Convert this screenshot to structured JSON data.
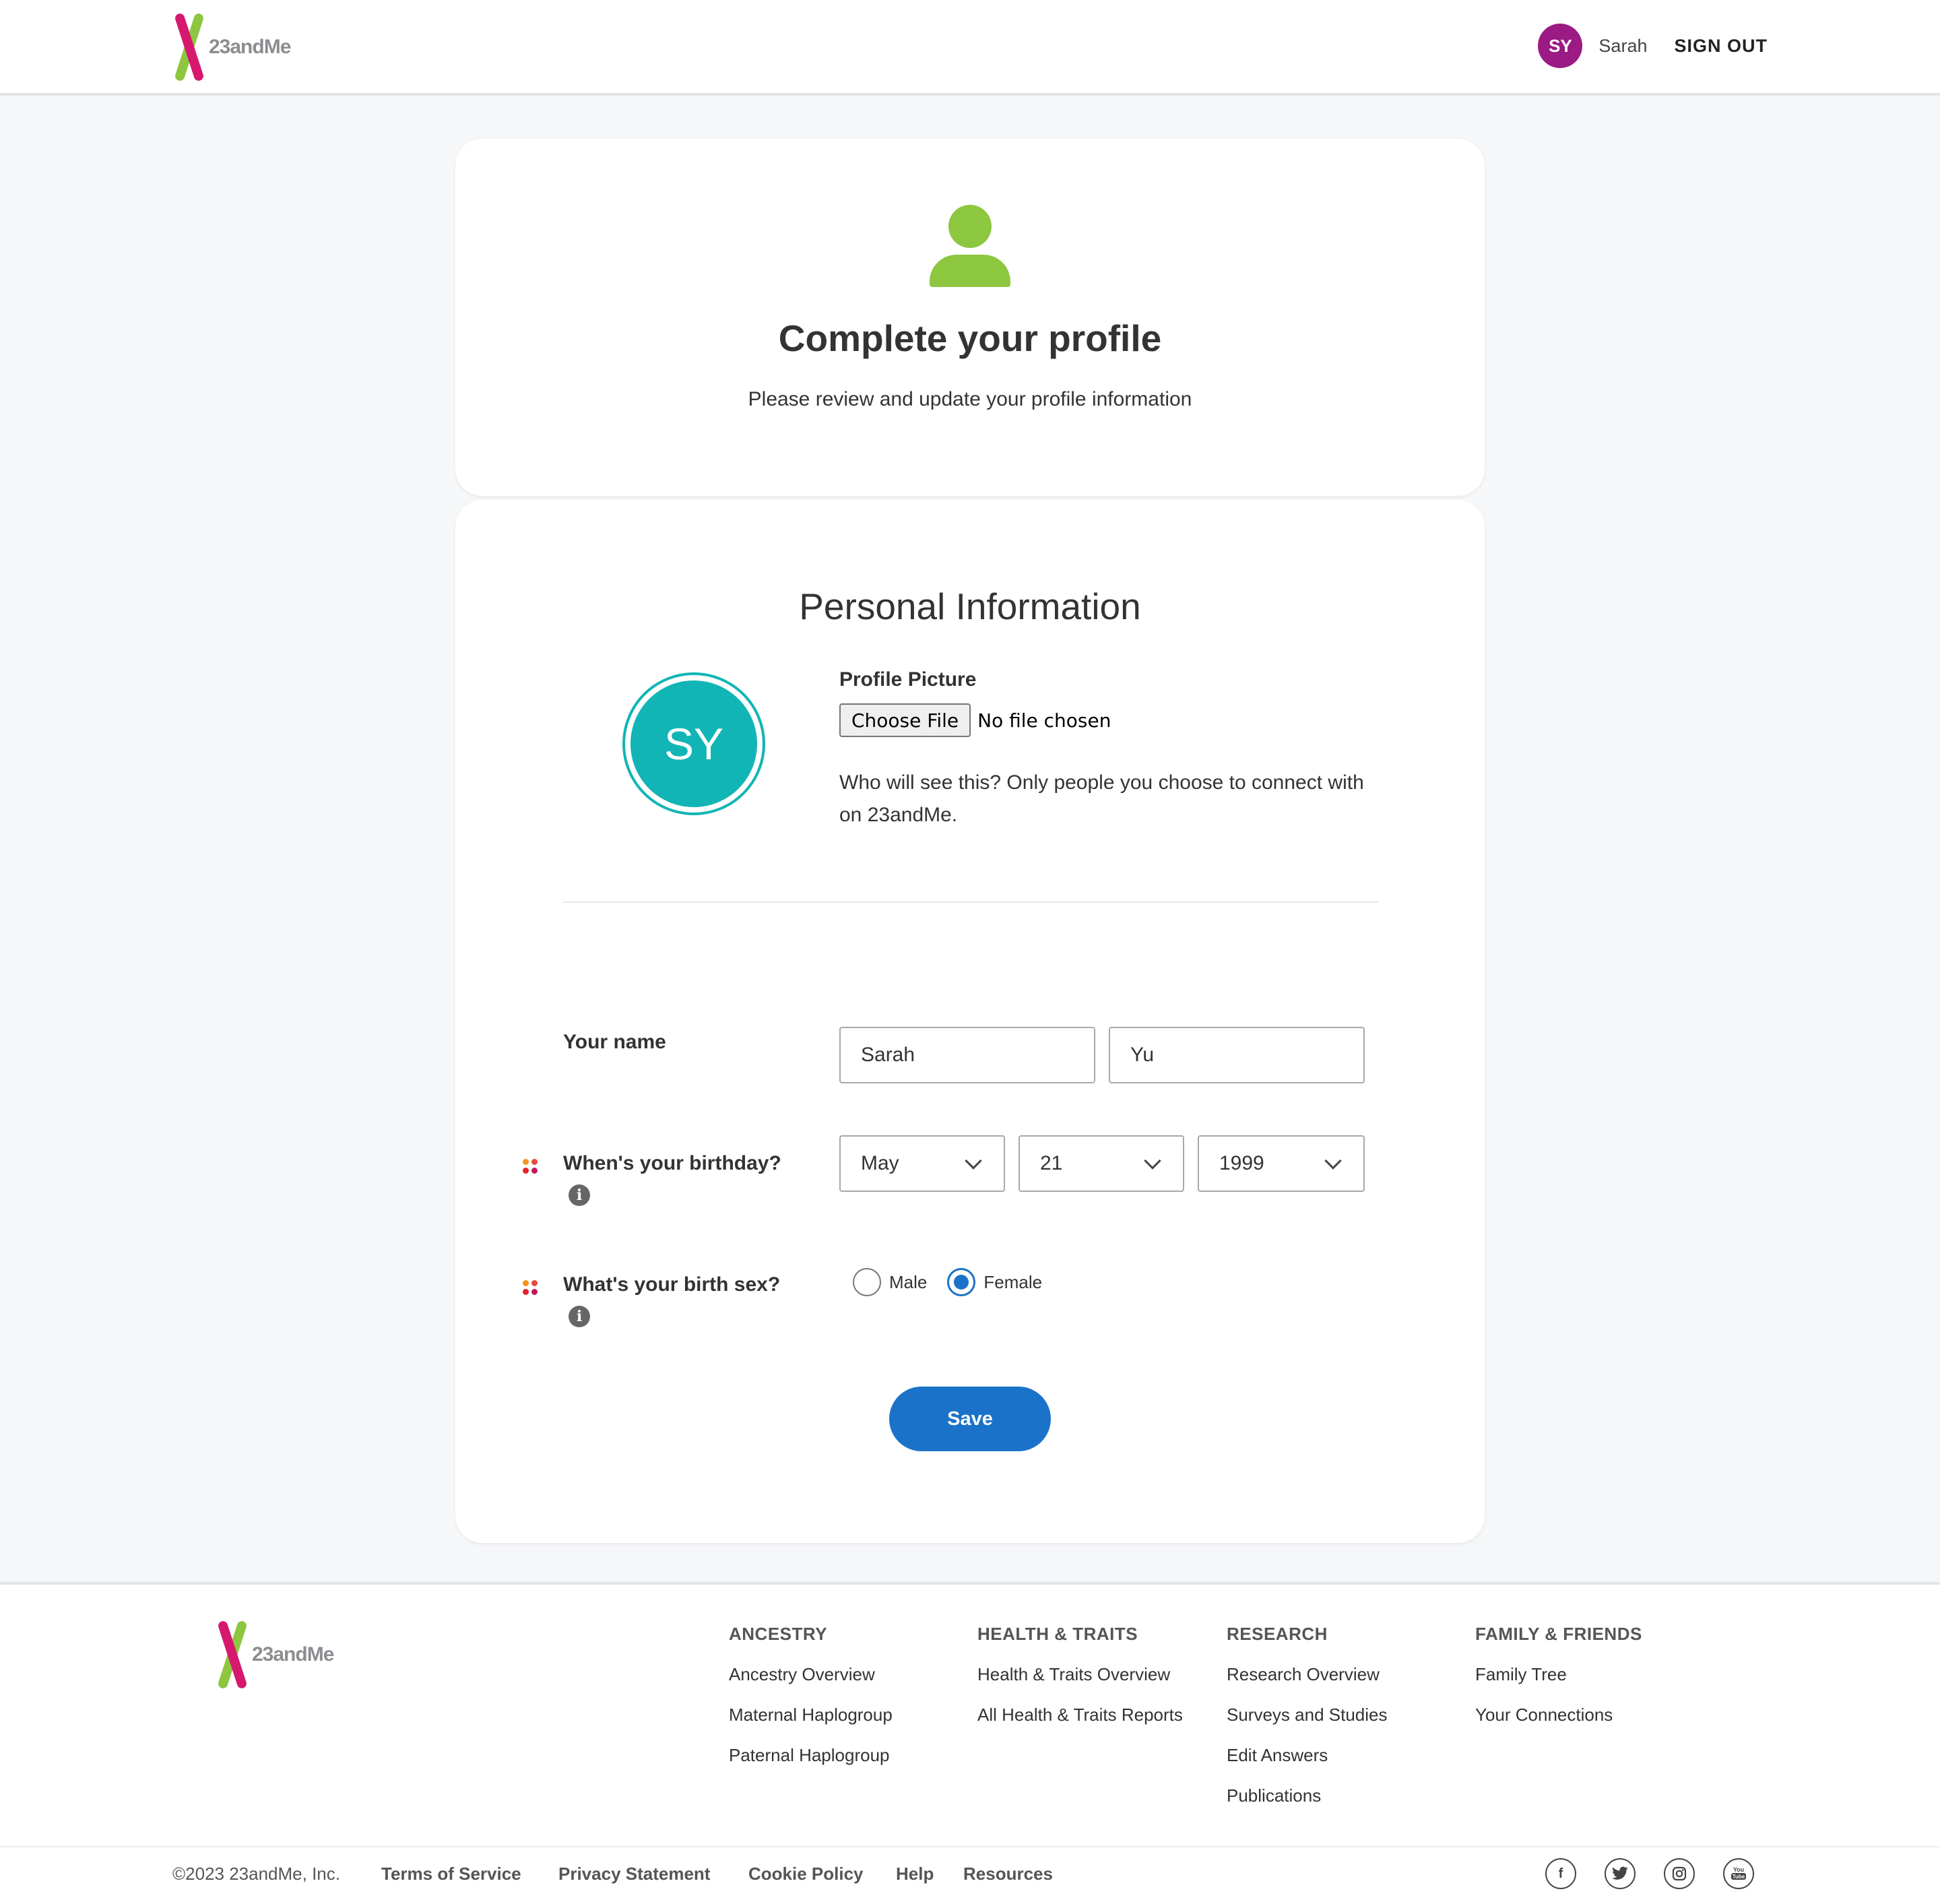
{
  "header": {
    "logo_text": "23andMe",
    "user_initials": "SY",
    "user_name": "Sarah",
    "sign_out_label": "SIGN OUT"
  },
  "intro": {
    "title": "Complete your profile",
    "subtitle": "Please review and update your profile information"
  },
  "personal": {
    "section_title": "Personal Information",
    "avatar_initials": "SY",
    "picture_label": "Profile Picture",
    "choose_file_label": "Choose File",
    "no_file_text": "No file chosen",
    "visibility_note": "Who will see this? Only people you choose to connect with on 23andMe.",
    "name_label": "Your name",
    "first_name": "Sarah",
    "last_name": "Yu",
    "birthday_label": "When's your birthday?",
    "birth_month": "May",
    "birth_day": "21",
    "birth_year": "1999",
    "sex_label": "What's your birth sex?",
    "sex_options": [
      "Male",
      "Female"
    ],
    "sex_selected": "Female",
    "save_label": "Save"
  },
  "footer": {
    "logo_text": "23andMe",
    "columns": [
      {
        "heading": "ANCESTRY",
        "links": [
          "Ancestry Overview",
          "Maternal Haplogroup",
          "Paternal Haplogroup"
        ]
      },
      {
        "heading": "HEALTH & TRAITS",
        "links": [
          "Health & Traits Overview",
          "All Health & Traits Reports"
        ]
      },
      {
        "heading": "RESEARCH",
        "links": [
          "Research Overview",
          "Surveys and Studies",
          "Edit Answers",
          "Publications"
        ]
      },
      {
        "heading": "FAMILY & FRIENDS",
        "links": [
          "Family Tree",
          "Your Connections"
        ]
      }
    ],
    "copyright": "©2023 23andMe, Inc.",
    "legal_links": [
      "Terms of Service",
      "Privacy Statement",
      "Cookie Policy",
      "Help",
      "Resources"
    ],
    "social_icons": [
      "facebook-icon",
      "twitter-icon",
      "instagram-icon",
      "youtube-icon"
    ]
  },
  "colors": {
    "brand_green": "#8dc63f",
    "brand_magenta": "#d6186f",
    "accent_blue": "#1a73c8",
    "avatar_teal": "#12b5b5",
    "user_avatar_purple": "#9b1a84"
  }
}
